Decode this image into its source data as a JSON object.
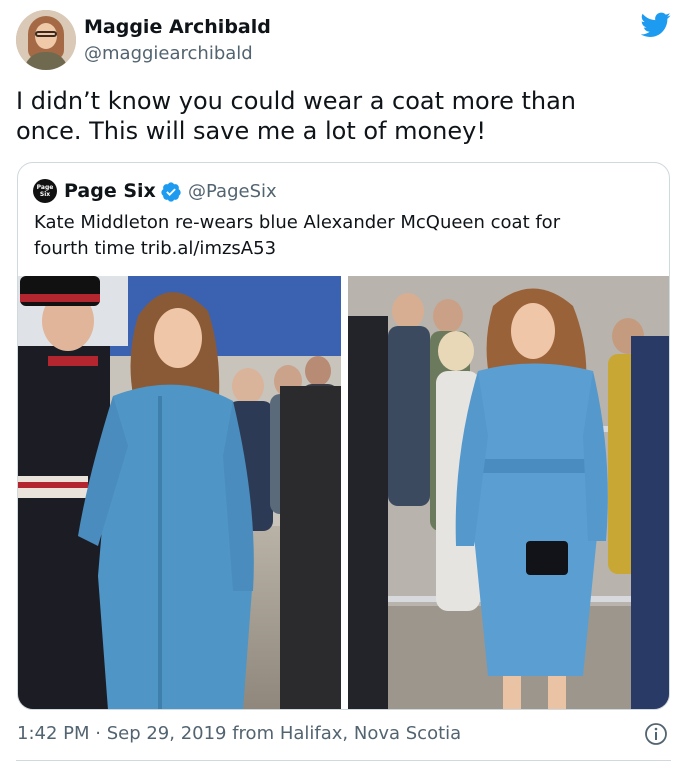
{
  "author": {
    "name": "Maggie Archibald",
    "handle": "@maggiearchibald",
    "avatar_icon": "user-avatar"
  },
  "brand_icon": "twitter-bird-icon",
  "accent_color": "#1d9bf0",
  "tweet": {
    "text": "I didn’t know you could wear a coat more than\nonce. This will save me a lot of money!"
  },
  "quoted": {
    "logo_text": "Page\nSix",
    "name": "Page Six",
    "verified_icon": "verified-badge-icon",
    "handle": "@PageSix",
    "text": "Kate Middleton re-wears blue Alexander McQueen coat for\nfourth time trib.al/imzsA53"
  },
  "footer": {
    "timestamp": "1:42 PM · Sep 29, 2019 from Halifax, Nova Scotia",
    "info_icon": "info-icon"
  }
}
